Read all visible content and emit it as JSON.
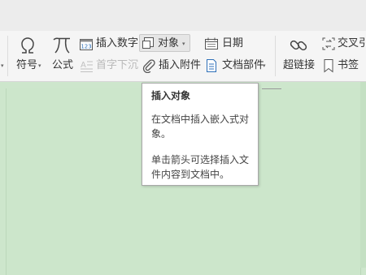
{
  "toolbar": {
    "symbol_label": "符号",
    "formula_label": "公式",
    "insert_number_label": "插入数字",
    "drop_cap_label": "首字下沉",
    "object_label": "对象",
    "attachment_label": "插入附件",
    "date_label": "日期",
    "doc_parts_label": "文档部件",
    "hyperlink_label": "超链接",
    "cross_ref_label": "交叉引",
    "bookmark_label": "书签"
  },
  "tooltip": {
    "title": "插入对象",
    "desc": "在文档中插入嵌入式对象。",
    "hint": "单击箭头可选择插入文件内容到文档中。"
  },
  "icons": {
    "symbol": "omega-icon",
    "formula": "pi-icon",
    "insert_number": "number-123-icon",
    "drop_cap": "drop-cap-icon",
    "object": "object-icon",
    "attachment": "paperclip-icon",
    "date": "calendar-icon",
    "doc_parts": "document-parts-icon",
    "hyperlink": "chain-link-icon",
    "cross_ref": "cross-reference-icon",
    "bookmark": "bookmark-icon"
  },
  "colors": {
    "ribbon_bg": "#f5f5f5",
    "document_bg": "#cde6cc",
    "icon_blue": "#2d6fb8",
    "icon_gray": "#444444"
  }
}
